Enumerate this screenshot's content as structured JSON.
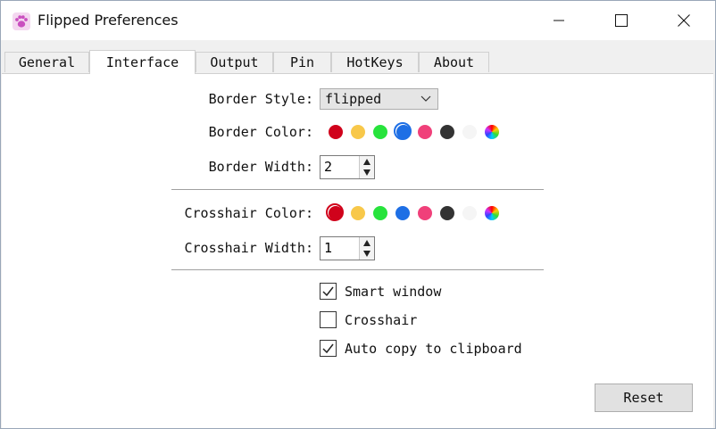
{
  "window": {
    "title": "Flipped Preferences"
  },
  "tabs": [
    {
      "label": "General"
    },
    {
      "label": "Interface"
    },
    {
      "label": "Output"
    },
    {
      "label": "Pin"
    },
    {
      "label": "HotKeys"
    },
    {
      "label": "About"
    }
  ],
  "active_tab": "Interface",
  "border": {
    "style_label": "Border Style:",
    "style_value": "flipped",
    "color_label": "Border Color:",
    "width_label": "Border Width:",
    "width_value": "2",
    "selected_color": "#1e6fe5"
  },
  "crosshair": {
    "color_label": "Crosshair Color:",
    "width_label": "Crosshair Width:",
    "width_value": "1",
    "selected_color": "#d0021b"
  },
  "palette": [
    "#d0021b",
    "#f8c84a",
    "#27e33c",
    "#1e6fe5",
    "#f0407a",
    "#333333",
    "#f5f5f5",
    "rainbow"
  ],
  "options": [
    {
      "label": "Smart window",
      "checked": true
    },
    {
      "label": "Crosshair",
      "checked": false
    },
    {
      "label": "Auto copy to clipboard",
      "checked": true
    }
  ],
  "reset_label": "Reset",
  "icons": {
    "app": "paw-icon",
    "minimize": "minimize-icon",
    "maximize": "maximize-icon",
    "close": "close-icon"
  }
}
